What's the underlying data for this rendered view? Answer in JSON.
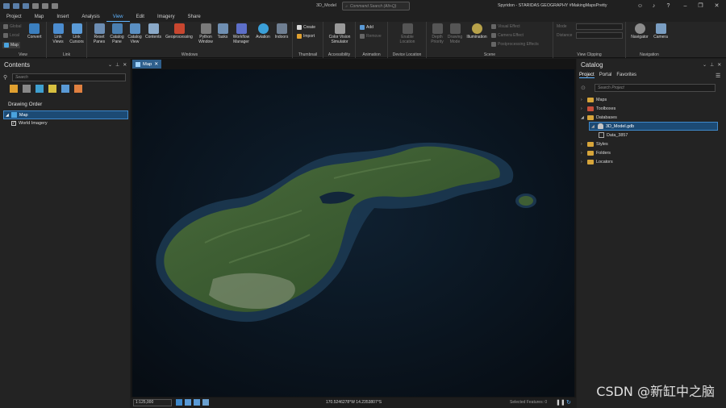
{
  "app": {
    "doc_title": "3D_Model",
    "search_placeholder": "Command Search (Alt+Q)",
    "user_label": "Spyridon - STARIDAS GEOGRAPHY #MakingMapsPretty"
  },
  "tabs": [
    "Project",
    "Map",
    "Insert",
    "Analysis",
    "View",
    "Edit",
    "Imagery",
    "Share"
  ],
  "active_tab": "View",
  "ribbon": {
    "view_group": {
      "label": "View",
      "global": "Global",
      "local": "Local",
      "map": "Map",
      "convert": "Convert"
    },
    "link_group": {
      "label": "Link",
      "link_views": "Link Views",
      "link_cursors": "Link Cursors"
    },
    "windows_group": {
      "label": "Windows",
      "reset_panes": "Reset Panes",
      "catalog_pane": "Catalog Pane",
      "catalog_view": "Catalog View",
      "contents": "Contents",
      "geoprocessing": "Geoprocessing",
      "python_window": "Python Window",
      "tasks": "Tasks",
      "workflow_manager": "Workflow Manager",
      "aviation": "Aviation",
      "indoors": "Indoors"
    },
    "thumbnail_group": {
      "label": "Thumbnail",
      "create": "Create",
      "import": "Import"
    },
    "accessibility_group": {
      "label": "Accessibility",
      "color_vision": "Color Vision Simulator"
    },
    "animation_group": {
      "label": "Animation",
      "add": "Add",
      "remove": "Remove"
    },
    "device_group": {
      "label": "Device Location",
      "enable_location": "Enable Location"
    },
    "scene_group": {
      "label": "Scene",
      "depth_priority": "Depth Priority",
      "drawing_mode": "Drawing Mode",
      "illumination": "Illumination",
      "visual_effect": "Visual Effect",
      "camera_effect": "Camera Effect",
      "postprocessing": "Postprocessing Effects"
    },
    "clipping_group": {
      "label": "View Clipping",
      "mode": "Mode",
      "distance": "Distance"
    },
    "navigation_group": {
      "label": "Navigation",
      "navigator": "Navigator",
      "camera": "Camera"
    }
  },
  "contents": {
    "title": "Contents",
    "search_placeholder": "Search",
    "drawing_order": "Drawing Order",
    "map_item": "Map",
    "layer_item": "World Imagery"
  },
  "map_view": {
    "tab_label": "Map",
    "scale": "1:125,000",
    "coordinates": "170.5246278°W 14.2353807°S",
    "selected_features": "Selected Features: 0"
  },
  "catalog": {
    "title": "Catalog",
    "tabs": [
      "Project",
      "Portal",
      "Favorites"
    ],
    "search_placeholder": "Search Project",
    "items": {
      "maps": "Maps",
      "toolboxes": "Toolboxes",
      "databases": "Databases",
      "gdb": "3D_Model.gdb",
      "data": "Data_3857",
      "styles": "Styles",
      "folders": "Folders",
      "locators": "Locators"
    }
  },
  "watermark": "CSDN @新缸中之脑",
  "colors": {
    "accent": "#5fb4ff",
    "selection": "#1c4a74",
    "water": "#0a121b",
    "land": "#3f5e34"
  }
}
